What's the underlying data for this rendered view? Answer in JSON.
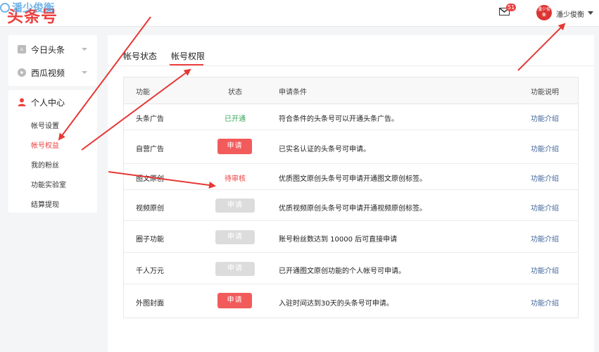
{
  "header": {
    "logo": "头条号",
    "watermark": "潘少俊衡",
    "mail_badge": "51",
    "avatar_text": "潘少俊衡",
    "username": "潘少俊衡"
  },
  "sidebar": {
    "group1": [
      {
        "label": "今日头条",
        "icon": "toutiao-icon"
      },
      {
        "label": "西瓜视频",
        "icon": "xigua-icon"
      }
    ],
    "personal": {
      "label": "个人中心",
      "items": [
        "帐号设置",
        "帐号权益",
        "我的粉丝",
        "功能实验室",
        "结算提现"
      ],
      "active_index": 1
    }
  },
  "tabs": [
    "帐号状态",
    "帐号权限"
  ],
  "active_tab": 1,
  "table": {
    "headers": {
      "name": "功能",
      "status": "状态",
      "condition": "申请条件",
      "desc": "功能说明"
    },
    "rows": [
      {
        "name": "头条广告",
        "status": "已开通",
        "status_type": "text-green",
        "condition": "符合条件的头条号可以开通头条广告。",
        "desc": "功能介绍"
      },
      {
        "name": "自营广告",
        "status": "申请",
        "status_type": "button-red",
        "condition": "已实名认证的头条号可申请。",
        "desc": "功能介绍"
      },
      {
        "name": "图文原创",
        "status": "待审核",
        "status_type": "text-red",
        "condition": "优质图文原创头条号可申请开通图文原创标签。",
        "desc": "功能介绍"
      },
      {
        "name": "视频原创",
        "status": "申请",
        "status_type": "button-gray",
        "condition": "优质视频原创头条号可申请开通视频原创标签。",
        "desc": "功能介绍"
      },
      {
        "name": "圈子功能",
        "status": "申请",
        "status_type": "button-gray",
        "condition": "账号粉丝数达到 10000 后可直接申请",
        "desc": "功能介绍"
      },
      {
        "name": "千人万元",
        "status": "申请",
        "status_type": "button-gray",
        "condition": "已开通图文原创功能的个人帐号可申请。",
        "desc": "功能介绍"
      },
      {
        "name": "外图封面",
        "status": "申请",
        "status_type": "button-red",
        "condition": "入驻时间达到30天的头条号可申请。",
        "desc": "功能介绍"
      }
    ]
  },
  "colors": {
    "accent": "#ed4040",
    "link": "#406599",
    "ok": "#3aa55d",
    "annotation_arrow": "#e53935"
  }
}
